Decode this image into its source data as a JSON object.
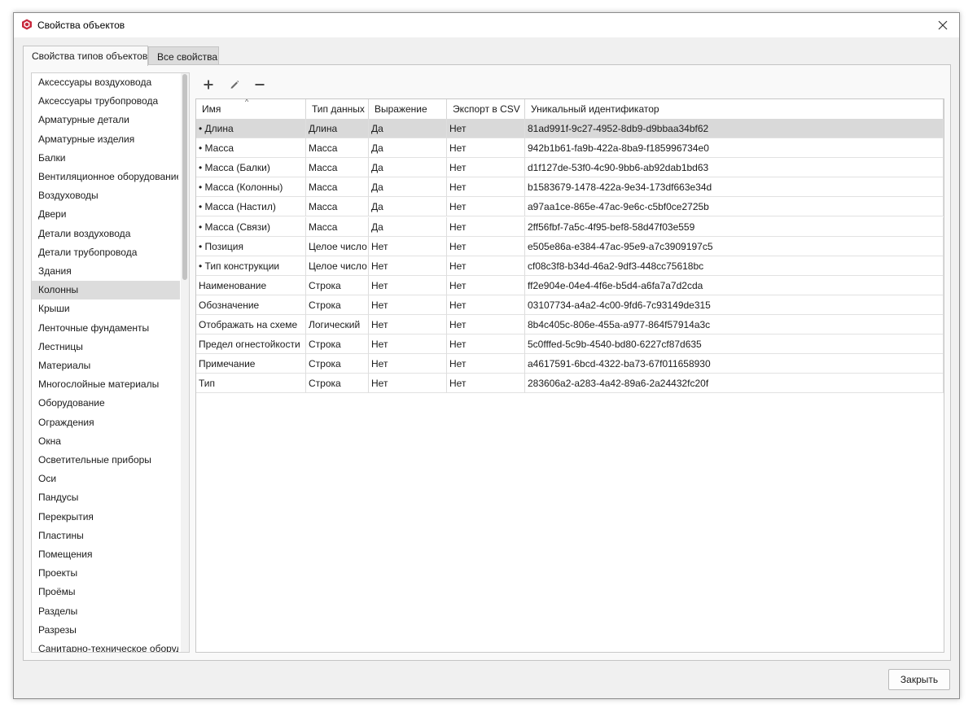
{
  "window": {
    "title": "Свойства объектов"
  },
  "tabs": [
    {
      "label": "Свойства типов объектов",
      "active": true
    },
    {
      "label": "Все свойства",
      "active": false
    }
  ],
  "object_types": {
    "selected": "Колонны",
    "items": [
      "Аксессуары воздуховода",
      "Аксессуары трубопровода",
      "Арматурные детали",
      "Арматурные изделия",
      "Балки",
      "Вентиляционное оборудование",
      "Воздуховоды",
      "Двери",
      "Детали воздуховода",
      "Детали трубопровода",
      "Здания",
      "Колонны",
      "Крыши",
      "Ленточные фундаменты",
      "Лестницы",
      "Материалы",
      "Многослойные материалы",
      "Оборудование",
      "Ограждения",
      "Окна",
      "Осветительные приборы",
      "Оси",
      "Пандусы",
      "Перекрытия",
      "Пластины",
      "Помещения",
      "Проекты",
      "Проёмы",
      "Разделы",
      "Разрезы",
      "Санитарно-техническое оборудование"
    ]
  },
  "toolbar": {
    "add_icon": "plus-icon",
    "edit_icon": "pencil-icon",
    "remove_icon": "minus-icon"
  },
  "table": {
    "sort_indicator": "^",
    "columns": [
      "Имя",
      "Тип данных",
      "Выражение",
      "Экспорт в CSV",
      "Уникальный идентификатор"
    ],
    "selected_row": 0,
    "rows": [
      [
        "• Длина",
        "Длина",
        "Да",
        "Нет",
        "81ad991f-9c27-4952-8db9-d9bbaa34bf62"
      ],
      [
        "• Масса",
        "Масса",
        "Да",
        "Нет",
        "942b1b61-fa9b-422a-8ba9-f185996734e0"
      ],
      [
        "• Масса (Балки)",
        "Масса",
        "Да",
        "Нет",
        "d1f127de-53f0-4c90-9bb6-ab92dab1bd63"
      ],
      [
        "• Масса (Колонны)",
        "Масса",
        "Да",
        "Нет",
        "b1583679-1478-422a-9e34-173df663e34d"
      ],
      [
        "• Масса (Настил)",
        "Масса",
        "Да",
        "Нет",
        "a97aa1ce-865e-47ac-9e6c-c5bf0ce2725b"
      ],
      [
        "• Масса (Связи)",
        "Масса",
        "Да",
        "Нет",
        "2ff56fbf-7a5c-4f95-bef8-58d47f03e559"
      ],
      [
        "• Позиция",
        "Целое число",
        "Нет",
        "Нет",
        "e505e86a-e384-47ac-95e9-a7c3909197c5"
      ],
      [
        "• Тип конструкции",
        "Целое число",
        "Нет",
        "Нет",
        "cf08c3f8-b34d-46a2-9df3-448cc75618bc"
      ],
      [
        "Наименование",
        "Строка",
        "Нет",
        "Нет",
        "ff2e904e-04e4-4f6e-b5d4-a6fa7a7d2cda"
      ],
      [
        "Обозначение",
        "Строка",
        "Нет",
        "Нет",
        "03107734-a4a2-4c00-9fd6-7c93149de315"
      ],
      [
        "Отображать на схеме",
        "Логический",
        "Нет",
        "Нет",
        "8b4c405c-806e-455a-a977-864f57914a3c"
      ],
      [
        "Предел огнестойкости",
        "Строка",
        "Нет",
        "Нет",
        "5c0fffed-5c9b-4540-bd80-6227cf87d635"
      ],
      [
        "Примечание",
        "Строка",
        "Нет",
        "Нет",
        "a4617591-6bcd-4322-ba73-67f011658930"
      ],
      [
        "Тип",
        "Строка",
        "Нет",
        "Нет",
        "283606a2-a283-4a42-89a6-2a24432fc20f"
      ]
    ]
  },
  "footer": {
    "close_label": "Закрыть"
  },
  "colors": {
    "accent": "#c8283c",
    "selection": "#d9d9d9"
  }
}
